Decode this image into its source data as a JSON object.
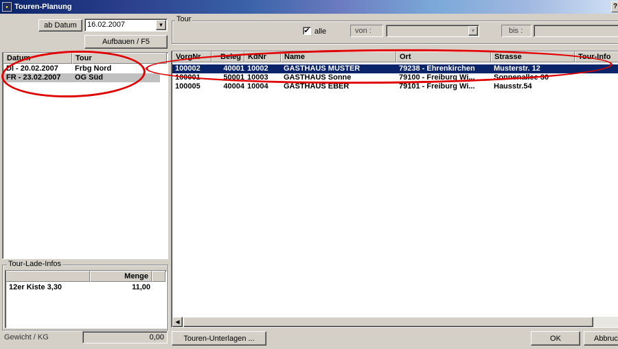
{
  "window": {
    "title": "Touren-Planung",
    "help_label": "?"
  },
  "left": {
    "ab_datum_label": "ab Datum",
    "date_value": "16.02.2007",
    "build_button": "Aufbauen / F5",
    "tour_list": {
      "columns": [
        "Datum",
        "Tour"
      ],
      "rows": [
        {
          "datum": "DI - 20.02.2007",
          "tour": "Frbg Nord"
        },
        {
          "datum": "FR - 23.02.2007",
          "tour": "OG Süd"
        }
      ]
    },
    "lade_infos": {
      "title": "Tour-Lade-Infos",
      "columns": [
        "",
        "Menge"
      ],
      "rows": [
        {
          "item": "12er Kiste 3,30",
          "menge": "11,00"
        }
      ]
    },
    "gewicht_label": "Gewicht / KG",
    "gewicht_value": "0,00"
  },
  "right": {
    "tour_group_label": "Tour",
    "alle_label": "alle",
    "alle_checked": true,
    "von_label": "von :",
    "bis_label": "bis :",
    "grid": {
      "columns": [
        "VorgNr",
        "Beleg",
        "KdNr",
        "Name",
        "Ort",
        "Strasse",
        "Tour-Info"
      ],
      "rows": [
        {
          "vorgnr": "100002",
          "beleg": "40001",
          "kdnr": "10002",
          "name": "GASTHAUS MUSTER",
          "ort": "79238 - Ehrenkirchen",
          "strasse": "Musterstr. 12",
          "selected": true
        },
        {
          "vorgnr": "100001",
          "beleg": "50001",
          "kdnr": "10003",
          "name": "GASTHAUS Sonne",
          "ort": "79100 - Freiburg Wi...",
          "strasse": "Sonnenallee 30",
          "selected": false
        },
        {
          "vorgnr": "100005",
          "beleg": "40004",
          "kdnr": "10004",
          "name": "GASTHAUS EBER",
          "ort": "79101 - Freiburg Wi...",
          "strasse": "Hausstr.54",
          "selected": false
        }
      ]
    },
    "touren_unterlagen_button": "Touren-Unterlagen ...",
    "ok_button": "OK",
    "abbruch_button": "Abbruch"
  },
  "colors": {
    "selection": "#0a246a",
    "annotation": "#e00000",
    "face": "#d4d0c8"
  }
}
